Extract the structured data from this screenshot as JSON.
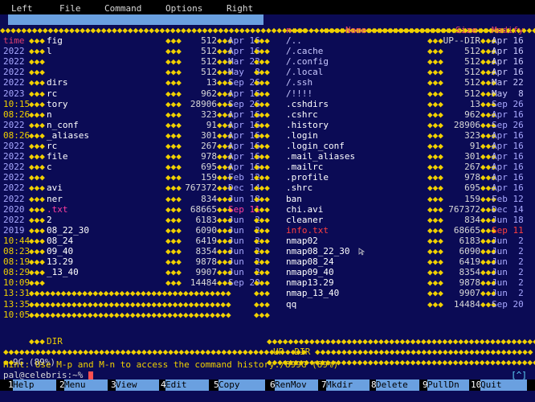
{
  "menu": [
    "Left",
    "File",
    "Command",
    "Options",
    "Right"
  ],
  "left_panel": {
    "path": "~/.",
    "path_suffix": "UP--DIR",
    "path_date": "Apr 16",
    "header": "time",
    "entries": [
      {
        "time": "time",
        "name": "fig",
        "size": "512",
        "date": "Apr 16"
      },
      {
        "time": "2022",
        "name": "l",
        "size": "512",
        "date": "Apr 16"
      },
      {
        "time": "2022",
        "name": "",
        "size": "512",
        "date": "Mar 22"
      },
      {
        "time": "2022",
        "name": "",
        "size": "512",
        "date": "May  8"
      },
      {
        "time": "2022",
        "name": "dirs",
        "size": "13",
        "date": "Sep 26"
      },
      {
        "time": "2023",
        "name": "rc",
        "size": "962",
        "date": "Apr 16"
      },
      {
        "time": "10:15",
        "name": "tory",
        "size": "28906",
        "date": "Sep 26"
      },
      {
        "time": "08:26",
        "name": "n",
        "size": "323",
        "date": "Apr 16"
      },
      {
        "time": "2022",
        "name": "n_conf",
        "size": "91",
        "date": "Apr 16"
      },
      {
        "time": "08:26",
        "name": "_aliases",
        "size": "301",
        "date": "Apr 16"
      },
      {
        "time": "2022",
        "name": "rc",
        "size": "267",
        "date": "Apr 16"
      },
      {
        "time": "2022",
        "name": "file",
        "size": "978",
        "date": "Apr 16"
      },
      {
        "time": "2022",
        "name": "c",
        "size": "695",
        "date": "Apr 16"
      },
      {
        "time": "2022",
        "name": "",
        "size": "159",
        "date": "Feb 12"
      },
      {
        "time": "2022",
        "name": "avi",
        "size": "767372",
        "date": "Dec 14"
      },
      {
        "time": "2022",
        "name": "ner",
        "size": "834",
        "date": "Jun 18"
      },
      {
        "time": "2020",
        "name": ".txt",
        "size": "68665",
        "date": "Sep 11"
      },
      {
        "time": "2022",
        "name": "2",
        "size": "6183",
        "date": "Jun  2"
      },
      {
        "time": "2019",
        "name": "08_22_30",
        "size": "6090",
        "date": "Jun  2"
      },
      {
        "time": "10:44",
        "name": "08_24",
        "size": "6419",
        "date": "Jun  2"
      },
      {
        "time": "08:23",
        "name": "09_40",
        "size": "8354",
        "date": "Jun  2"
      },
      {
        "time": "08:19",
        "name": "13.29",
        "size": "9878",
        "date": "Jun  2"
      },
      {
        "time": "08:29",
        "name": "_13_40",
        "size": "9907",
        "date": "Jun  2"
      },
      {
        "time": "10:09",
        "name": "",
        "size": "14484",
        "date": "Sep 20"
      },
      {
        "time": "13:31",
        "name": "",
        "size": "",
        "date": ""
      },
      {
        "time": "13:35",
        "name": "",
        "size": "",
        "date": ""
      },
      {
        "time": "10:05",
        "name": "",
        "size": "",
        "date": ""
      }
    ],
    "footer_label": "DIR",
    "summary": "9G (89%)"
  },
  "right_panel": {
    "path": "~",
    "header_name": "Name",
    "header_size": "Size",
    "header_modify": "Modify",
    "header_n": "n",
    "entries": [
      {
        "name": "/..",
        "size": "UP--DIR",
        "date": "Apr 16",
        "kind": "dir"
      },
      {
        "name": "/.cache",
        "size": "512",
        "date": "Apr 16",
        "kind": "dir"
      },
      {
        "name": "/.config",
        "size": "512",
        "date": "Apr 16",
        "kind": "dir"
      },
      {
        "name": "/.local",
        "size": "512",
        "date": "Apr 16",
        "kind": "dir"
      },
      {
        "name": "/.ssh",
        "size": "512",
        "date": "Mar 22",
        "kind": "dir"
      },
      {
        "name": "/!!!!",
        "size": "512",
        "date": "May  8",
        "kind": "dir"
      },
      {
        "name": ".cshdirs",
        "size": "13",
        "date": "Sep 26",
        "kind": "file"
      },
      {
        "name": ".cshrc",
        "size": "962",
        "date": "Apr 16",
        "kind": "file"
      },
      {
        "name": ".history",
        "size": "28906",
        "date": "Sep 26",
        "kind": "file"
      },
      {
        "name": ".login",
        "size": "323",
        "date": "Apr 16",
        "kind": "file"
      },
      {
        "name": ".login_conf",
        "size": "91",
        "date": "Apr 16",
        "kind": "file"
      },
      {
        "name": ".mail_aliases",
        "size": "301",
        "date": "Apr 16",
        "kind": "file"
      },
      {
        "name": ".mailrc",
        "size": "267",
        "date": "Apr 16",
        "kind": "file"
      },
      {
        "name": ".profile",
        "size": "978",
        "date": "Apr 16",
        "kind": "file"
      },
      {
        "name": ".shrc",
        "size": "695",
        "date": "Apr 16",
        "kind": "file"
      },
      {
        "name": "ban",
        "size": "159",
        "date": "Feb 12",
        "kind": "file"
      },
      {
        "name": "chi.avi",
        "size": "767372",
        "date": "Dec 14",
        "kind": "file"
      },
      {
        "name": "cleaner",
        "size": "834",
        "date": "Jun 18",
        "kind": "file"
      },
      {
        "name": "info.txt",
        "size": "68665",
        "date": "Sep 11",
        "kind": "red"
      },
      {
        "name": "nmap02",
        "size": "6183",
        "date": "Jun  2",
        "kind": "file"
      },
      {
        "name": "nmap08_22_30",
        "size": "6090",
        "date": "Jun  2",
        "kind": "file"
      },
      {
        "name": "nmap08_24",
        "size": "6419",
        "date": "Jun  2",
        "kind": "file"
      },
      {
        "name": "nmap09_40",
        "size": "8354",
        "date": "Jun  2",
        "kind": "file"
      },
      {
        "name": "nmap13.29",
        "size": "9878",
        "date": "Jun  2",
        "kind": "file"
      },
      {
        "name": "nmap_13_40",
        "size": "9907",
        "date": "Jun  2",
        "kind": "file"
      },
      {
        "name": "qq",
        "size": "14484",
        "date": "Sep 20",
        "kind": "file"
      }
    ],
    "footer_label": "UP--DIR",
    "summary": "/899G (89%)"
  },
  "hint": "Hint: Use M-p and M-n to access the command history.",
  "prompt": "pal@celebris:~%",
  "indicator": "[^]",
  "fkeys": [
    {
      "num": "1",
      "label": "Help"
    },
    {
      "num": "2",
      "label": "Menu"
    },
    {
      "num": "3",
      "label": "View"
    },
    {
      "num": "4",
      "label": "Edit"
    },
    {
      "num": "5",
      "label": "Copy"
    },
    {
      "num": "6",
      "label": "RenMov"
    },
    {
      "num": "7",
      "label": "Mkdir"
    },
    {
      "num": "8",
      "label": "Delete"
    },
    {
      "num": "9",
      "label": "PullDn"
    },
    {
      "num": "10",
      "label": "Quit"
    }
  ],
  "colors": {
    "background": "#0b0b55",
    "accent": "#6aa0e0",
    "glyph": "#f0d000",
    "header": "#e04070",
    "error": "#ff4040"
  }
}
